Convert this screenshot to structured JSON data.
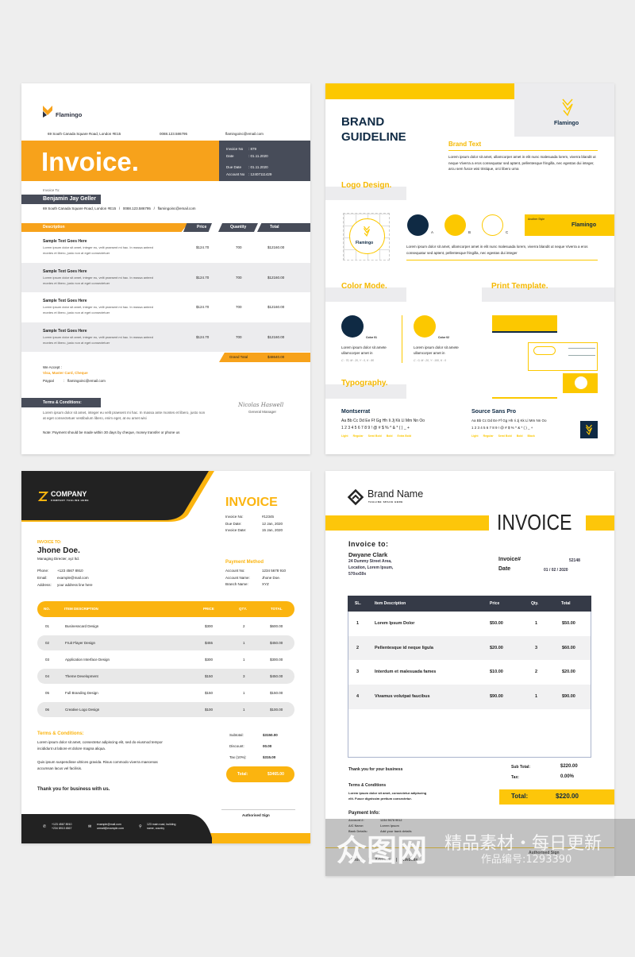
{
  "colors": {
    "flamingo_orange": "#f7a21b",
    "flamingo_dark": "#474c59",
    "brand_yellow": "#fcc800",
    "brand_navy": "#0f2a44",
    "company_yellow": "#fbb40f",
    "company_dark": "#222222",
    "brandname_yellow": "#fdc60a",
    "brandname_dark": "#353a47"
  },
  "invoice_a": {
    "brand": "Flamingo",
    "address": "69 South Canada Square Road, London #E15",
    "phone": "0088.123.586795",
    "email": "flamingoinc@email.com",
    "title": "Invoice.",
    "meta": [
      {
        "label": "Invoice No",
        "value": ": 879"
      },
      {
        "label": "Date",
        "value": ": 01.11.2020"
      },
      {
        "label": "Due Date",
        "value": ": 01.11.2020"
      },
      {
        "label": "Account No",
        "value": ": 12407111429"
      }
    ],
    "invoice_to_label": "Invoice To:",
    "client_name": "Benjamin Jay Geller",
    "client_line": "69 South Canada Square Road, London #E15   /   0088.123.586795   /   flamingoinc@email.com",
    "columns": [
      "Description",
      "Price",
      "Quantity",
      "Total"
    ],
    "rows": [
      {
        "title": "Sample Text Goes Here",
        "desc1": "Lorem ipsum dolor sit amet, integer eu, velit praesent mi hac. In massa anteed",
        "desc2": "montes et libero, justo non at eget consectetuer",
        "price": "$124.70",
        "qty": "700",
        "total": "$12160.00"
      },
      {
        "title": "Sample Text Goes Here",
        "desc1": "Lorem ipsum dolor sit amet, integer eu, velit praesent mi hac. In massa anteed",
        "desc2": "montes et libero, justo non at eget consectetuer",
        "price": "$124.70",
        "qty": "700",
        "total": "$12160.00"
      },
      {
        "title": "Sample Text Goes Here",
        "desc1": "Lorem ipsum dolor sit amet, integer eu, velit praesent mi hac. In massa anteed",
        "desc2": "montes et libero, justo non at eget consectetuer",
        "price": "$124.70",
        "qty": "700",
        "total": "$12160.00"
      },
      {
        "title": "Sample Text Goes Here",
        "desc1": "Lorem ipsum dolor sit amet, integer eu, velit praesent mi hac. In massa anteed",
        "desc2": "montes et libero, justo non at eget consectetuer",
        "price": "$124.70",
        "qty": "700",
        "total": "$12160.00"
      }
    ],
    "grand_total_label": "Grand Total",
    "grand_total": "$48640.00",
    "we_accept_label": "We Accept  :",
    "we_accept": "Visa, Master Card, Cheque",
    "paypal_label": "Paypal",
    "paypal": ":   flamingoinc@email.com",
    "terms_label": "Terms & Conditions:",
    "terms1": "Lorem ipsum dolor sit amet, integer eu velit praesent mi hac. In massa ante montes et libero, justo non",
    "terms2": "at eget consectetuer vestibulum libero, enim eget, at eu amet wisi",
    "note": "Note: Payment should be made within 30 days by cheque, money transfer or phone us",
    "signature": "Nicolas Haswell",
    "signer_title": "General Manager"
  },
  "brand_guide": {
    "title1": "BRAND",
    "title2": "GUIDELINE",
    "brand": "Flamingo",
    "brand_text_heading": "Brand Text",
    "brand_text": "Lorem ipsum dolor sit amet, ullamcorper amet in elit nunc malesuada lorem, viverra blandit ut neque Viverra a eros consequatur sed aptent, pellentesque fringilla, nec egestas dui integer, arcu sem fusce wisi tristique, orci libero urna",
    "logo_heading": "Logo Design.",
    "variants": [
      "A",
      "B",
      "C"
    ],
    "another_style": "Another Style",
    "logo_text": "Lorem ipsum dolor sit amet, ullamcorper amet in elit nunc malesuada lorem, viverra blandit ut neque Viverra a eros consequatur sed aptent, pellentesque fringilla, nec egestas dui integer",
    "color_heading": "Color Mode.",
    "colors": [
      {
        "name": "Color 01",
        "text1": "Lorem ipsum dolor sit amete",
        "text2": "ullamcorper amet in",
        "cmyk": "C : 70, M : 20, Y : 0, K : 80",
        "hex": "#0f2a44"
      },
      {
        "name": "Color 02",
        "text1": "Lorem ipsum dolor sit amete",
        "text2": "ullamcorper amet in",
        "cmyk": "C : 0, M : 20, Y : 100, K : 0",
        "hex": "#fcc800"
      }
    ],
    "print_heading": "Print Template.",
    "typo_heading": "Typography.",
    "fonts": [
      {
        "name": "Montserrat",
        "sample1": "Aa Bb Cc Dd Ee Ff Gg Hh Ii Jj Kk Ll Mm Nn Oo",
        "sample2": "1 2 3 4 5 6 7 8 9 ! @ # $ % ^ & * ( ) _ +",
        "weights": [
          "Light",
          "Regular",
          "Semi Bold",
          "Bold",
          "Extra Bold"
        ]
      },
      {
        "name": "Source Sans Pro",
        "sample1": "Aa Bb Cc Dd Ee Ff Gg Hh Ii Jj Kk Ll Mm Nn Oo",
        "sample2": "1 2 3 4 5 6 7 8 9 ! @ # $ % ^ & * ( ) _ +",
        "weights": [
          "Light",
          "Regular",
          "Semi Bold",
          "Bold",
          "Black"
        ]
      }
    ]
  },
  "invoice_c": {
    "company": "COMPANY",
    "tagline": "COMPANY TAGLINE HERE",
    "title": "INVOICE",
    "meta": [
      {
        "label": "Invoice No:",
        "value": "#12345"
      },
      {
        "label": "Due Date:",
        "value": "12 Jan, 2020"
      },
      {
        "label": "Invoice Date:",
        "value": "15 Jan, 2020"
      }
    ],
    "invoice_to_label": "INVOICE TO:",
    "client_name": "Jhone Doe.",
    "client_role": "Managing Directer, xyz ltd.",
    "contact": [
      {
        "label": "Phone:",
        "value": "+123 4567 8910"
      },
      {
        "label": "Email:",
        "value": "example@mail.com"
      },
      {
        "label": "Address:",
        "value": "your address line here"
      }
    ],
    "payment_heading": "Payment Method",
    "payment": [
      {
        "label": "Account No:",
        "value": "1234 5678 910"
      },
      {
        "label": "Account Name:",
        "value": "Jhone Doe."
      },
      {
        "label": "Branch Name:",
        "value": "XYZ"
      }
    ],
    "columns": [
      "NO.",
      "ITEM DESCRIPTION",
      "PRICE",
      "QTY.",
      "TOTAL"
    ],
    "rows": [
      {
        "no": "01",
        "item": "Businesscard Design",
        "price": "$300",
        "qty": "2",
        "total": "$600.00"
      },
      {
        "no": "02",
        "item": "Fruit Flayer Design",
        "price": "$455",
        "qty": "1",
        "total": "$450.00"
      },
      {
        "no": "03",
        "item": "Application Interface Design",
        "price": "$300",
        "qty": "1",
        "total": "$300.00"
      },
      {
        "no": "04",
        "item": "Theme Development",
        "price": "$150",
        "qty": "3",
        "total": "$450.00"
      },
      {
        "no": "05",
        "item": "Full Branding Design",
        "price": "$150",
        "qty": "1",
        "total": "$150.00"
      },
      {
        "no": "06",
        "item": "Creative Logo Design",
        "price": "$100",
        "qty": "1",
        "total": "$100.00"
      }
    ],
    "terms_heading": "Terms & Conditions:",
    "terms1": "Lorem ipsum dolor sit amet, consectetur adipiscing elit, sed do eiusmod tempor",
    "terms2": "incididunt ut labore et dolore magna aliqua.",
    "terms3": "Quis ipsum suspendisse ultrices gravida. Risus commodo viverra maecenas",
    "terms4": "accumsan lacus vel facilisis.",
    "thanks": "Thank you for business with us.",
    "summary": [
      {
        "label": "Subtotal:",
        "value": "$3150.00"
      },
      {
        "label": "Discount:",
        "value": "00.00"
      },
      {
        "label": "Tax (10%):",
        "value": "$315.00"
      }
    ],
    "total_label": "Total:",
    "total": "$3465.00",
    "sign": "Authorised Sign",
    "footer": {
      "phone1": "+123 4567 8910",
      "phone2": "+234 8910 4567",
      "email1": "example@mail.com",
      "email2": "urmail@example.com",
      "addr1": "123 main road, building",
      "addr2": "name, country"
    }
  },
  "invoice_d": {
    "brand": "Brand Name",
    "tagline": "TAGLINE SPACE HERE",
    "title": "INVOICE",
    "invoice_to_label": "Invoice to:",
    "client_name": "Dwyane Clark",
    "addr1": "24 Dummy Street Area,",
    "addr2": "Location, Lorem Ipsum,",
    "addr3": "570xx59x",
    "invoice_no_label": "Invoice#",
    "invoice_no": "52148",
    "date_label": "Date",
    "date": "01 / 02 / 2020",
    "columns": [
      "SL.",
      "Item Description",
      "Price",
      "Qty.",
      "Total"
    ],
    "rows": [
      {
        "sl": "1",
        "item": "Lorem Ipsum Dolor",
        "price": "$50.00",
        "qty": "1",
        "total": "$50.00"
      },
      {
        "sl": "2",
        "item": "Pellentesque id neque ligula",
        "price": "$20.00",
        "qty": "3",
        "total": "$60.00"
      },
      {
        "sl": "3",
        "item": "Interdum et malesuada fames",
        "price": "$10.00",
        "qty": "2",
        "total": "$20.00"
      },
      {
        "sl": "4",
        "item": "Vivamus volutpat faucibus",
        "price": "$90.00",
        "qty": "1",
        "total": "$90.00"
      }
    ],
    "thanks": "Thank you for your business",
    "terms_heading": "Terms & Conditions",
    "terms1": "Lorem ipsum dolor sit amet, consectetur adipiscing",
    "terms2": "elit. Fusce dignissim pretium consectetur.",
    "payment_heading": "Payment Info:",
    "payment": [
      {
        "label": "Account #:",
        "value": "1234 5678 9012"
      },
      {
        "label": "A/C Name:",
        "value": "Lorem Ipsum"
      },
      {
        "label": "Bank Details:",
        "value": "Add your bank details"
      }
    ],
    "subtotal_label": "Sub Total:",
    "subtotal": "$220.00",
    "tax_label": "Tax:",
    "tax": "0.00%",
    "total_label": "Total:",
    "total": "$220.00",
    "sign": "Authorised Sign",
    "footer": [
      "Phone",
      "|",
      "Address",
      "|",
      "Website"
    ]
  },
  "watermark": {
    "logo": "众图网",
    "slogan": "精品素材・每日更新",
    "code": "作品编号:1293390"
  }
}
